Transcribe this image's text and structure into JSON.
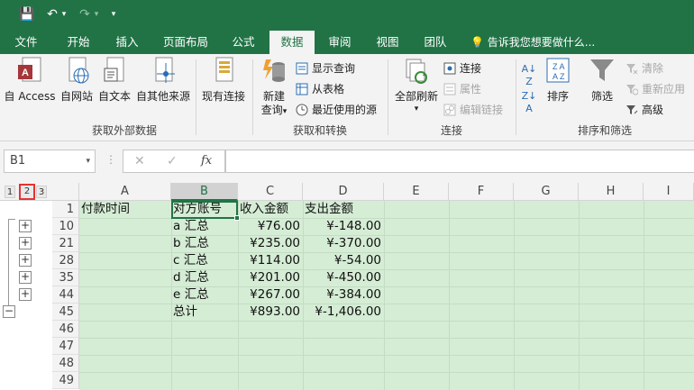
{
  "quick_access": {
    "save": "💾",
    "undo": "↶",
    "undo_dd": "▾",
    "redo": "↷",
    "redo_dd": "▾",
    "customize": "▾"
  },
  "tabs": [
    {
      "label": "文件",
      "active": false
    },
    {
      "label": "开始",
      "active": false
    },
    {
      "label": "插入",
      "active": false
    },
    {
      "label": "页面布局",
      "active": false
    },
    {
      "label": "公式",
      "active": false
    },
    {
      "label": "数据",
      "active": true
    },
    {
      "label": "审阅",
      "active": false
    },
    {
      "label": "视图",
      "active": false
    },
    {
      "label": "团队",
      "active": false
    }
  ],
  "tell_me": "告诉我您想要做什么...",
  "ribbon": {
    "get_external": {
      "label": "获取外部数据",
      "buttons": [
        "自 Access",
        "自网站",
        "自文本",
        "自其他来源",
        "现有连接"
      ]
    },
    "get_transform": {
      "label": "获取和转换",
      "new_query": [
        "新建",
        "查询"
      ],
      "new_query_dd": "▾",
      "small": [
        "显示查询",
        "从表格",
        "最近使用的源"
      ]
    },
    "connections": {
      "label": "连接",
      "refresh_all": "全部刷新",
      "refresh_dd": "▾",
      "small": [
        "连接",
        "属性",
        "编辑链接"
      ]
    },
    "sort_filter": {
      "label": "排序和筛选",
      "sort": "排序",
      "filter": "筛选",
      "small": [
        "清除",
        "重新应用",
        "高级"
      ]
    }
  },
  "formula_bar": {
    "name_box": "B1",
    "name_box_dd": "▾",
    "fx": "fx",
    "cancel": "✕",
    "enter": "✓",
    "value": ""
  },
  "outline": {
    "levels": [
      "1",
      "2",
      "3"
    ],
    "highlighted_level": "2",
    "expand_buttons": [
      "+",
      "+",
      "+",
      "+",
      "+"
    ],
    "collapse_button": "−"
  },
  "columns": [
    "A",
    "B",
    "C",
    "D",
    "E",
    "F",
    "G",
    "H",
    "I"
  ],
  "selected_cell": "B1",
  "rows": [
    {
      "num": "1",
      "a": "付款时间",
      "b": "对方账号",
      "c": "收入金额",
      "d": "支出金额"
    },
    {
      "num": "10",
      "a": "",
      "b": "a 汇总",
      "c": "¥76.00",
      "d": "¥-148.00"
    },
    {
      "num": "21",
      "a": "",
      "b": "b 汇总",
      "c": "¥235.00",
      "d": "¥-370.00"
    },
    {
      "num": "28",
      "a": "",
      "b": "c 汇总",
      "c": "¥114.00",
      "d": "¥-54.00"
    },
    {
      "num": "35",
      "a": "",
      "b": "d 汇总",
      "c": "¥201.00",
      "d": "¥-450.00"
    },
    {
      "num": "44",
      "a": "",
      "b": "e 汇总",
      "c": "¥267.00",
      "d": "¥-384.00"
    },
    {
      "num": "45",
      "a": "",
      "b": "总计",
      "c": "¥893.00",
      "d": "¥-1,406.00"
    },
    {
      "num": "46",
      "a": "",
      "b": "",
      "c": "",
      "d": ""
    },
    {
      "num": "47",
      "a": "",
      "b": "",
      "c": "",
      "d": ""
    },
    {
      "num": "48",
      "a": "",
      "b": "",
      "c": "",
      "d": ""
    },
    {
      "num": "49",
      "a": "",
      "b": "",
      "c": "",
      "d": ""
    }
  ],
  "colors": {
    "accent": "#217346",
    "sheet_fill": "#d5ecd5",
    "highlight_box": "#e53333"
  }
}
